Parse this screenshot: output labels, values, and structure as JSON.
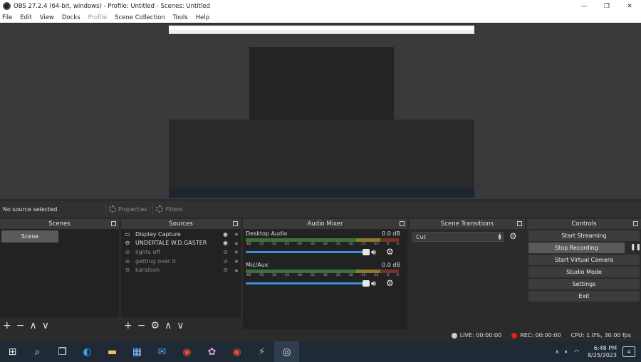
{
  "window": {
    "title": "OBS 27.2.4 (64-bit, windows) - Profile: Untitled - Scenes: Untitled",
    "minimize_icon": "—",
    "restore_icon": "❐",
    "close_icon": "✕"
  },
  "menu": [
    "File",
    "Edit",
    "View",
    "Docks",
    "Profile",
    "Scene Collection",
    "Tools",
    "Help"
  ],
  "context_bar": {
    "no_source": "No source selected",
    "properties": "Properties",
    "filters": "Filters"
  },
  "scenes": {
    "title": "Scenes",
    "items": [
      "Scene"
    ]
  },
  "sources": {
    "title": "Sources",
    "items": [
      {
        "label": "Display Capture",
        "icon": "monitor-icon",
        "visible": true
      },
      {
        "label": "UNDERTALE W.D.GASTER",
        "icon": "link-icon",
        "visible": true
      },
      {
        "label": "lights off",
        "icon": "link-icon",
        "visible": false
      },
      {
        "label": "getting over it",
        "icon": "link-icon",
        "visible": false
      },
      {
        "label": "karalson",
        "icon": "link-icon",
        "visible": false
      }
    ]
  },
  "audio_mixer": {
    "title": "Audio Mixer",
    "ticks": [
      "-60",
      "-55",
      "-50",
      "-45",
      "-40",
      "-35",
      "-30",
      "-25",
      "-20",
      "-15",
      "-10",
      "-5",
      "0"
    ],
    "channels": [
      {
        "name": "Desktop Audio",
        "db": "0.0 dB"
      },
      {
        "name": "Mic/Aux",
        "db": "0.0 dB"
      }
    ]
  },
  "scene_transitions": {
    "title": "Scene Transitions",
    "selected": "Cut"
  },
  "controls": {
    "title": "Controls",
    "buttons": [
      "Start Streaming",
      "Stop Recording",
      "Start Virtual Camera",
      "Studio Mode",
      "Settings",
      "Exit"
    ]
  },
  "status": {
    "live": "LIVE: 00:00:00",
    "rec": "REC: 00:00:00",
    "cpu": "CPU: 1.0%, 30.00 fps",
    "rec_color": "#e02020"
  },
  "taskbar": {
    "time": "6:48 PM",
    "date": "8/25/2023",
    "notifications": "4"
  }
}
